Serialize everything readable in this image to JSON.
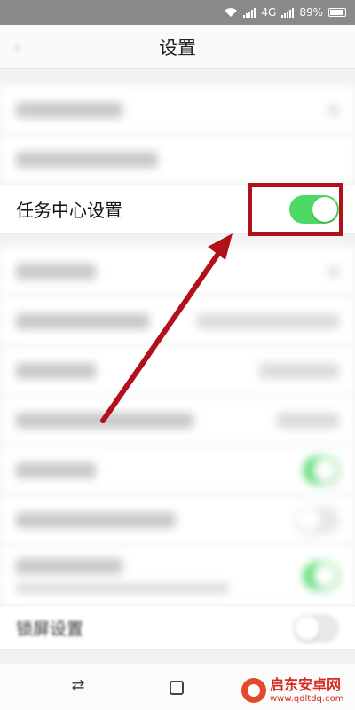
{
  "status_bar": {
    "network": "4G",
    "battery": "89%"
  },
  "nav": {
    "title": "设置"
  },
  "settings": {
    "task_center_label": "任务中心设置",
    "task_center_enabled": true,
    "partial_row_label": "锁屏设置"
  },
  "watermark": {
    "name": "启东安卓网",
    "url": "www.qdltdq.com"
  },
  "colors": {
    "toggle_on": "#4cd964",
    "highlight": "#b0111b"
  },
  "icons": {
    "back": "back-arrow-icon",
    "nav_back": "nav-back-icon",
    "nav_home": "nav-home-icon",
    "wifi": "wifi-icon",
    "signal": "signal-icon",
    "battery": "battery-icon"
  }
}
